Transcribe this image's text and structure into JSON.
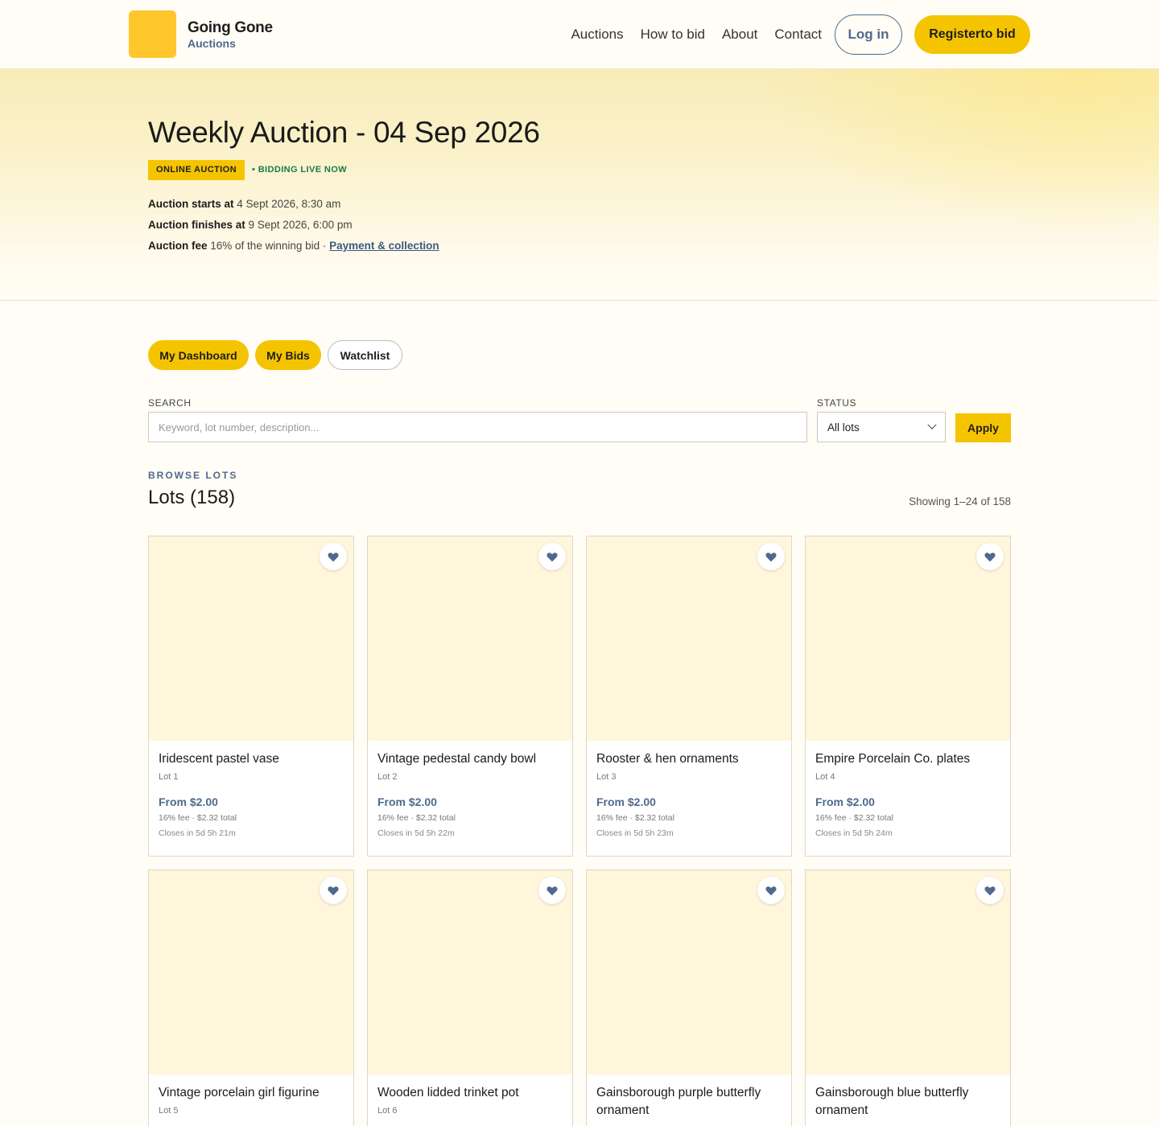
{
  "header": {
    "brand_name": "Going Gone",
    "brand_sub": "Auctions",
    "nav": [
      "Auctions",
      "How to bid",
      "About",
      "Contact"
    ],
    "login_label": "Log in",
    "register_label": "Registerto bid"
  },
  "hero": {
    "title": "Weekly Auction - 04 Sep 2026",
    "badge_online": "ONLINE AUCTION",
    "badge_live": "• BIDDING LIVE NOW",
    "starts_label": "Auction starts at",
    "starts_value": "4 Sept 2026, 8:30 am",
    "finishes_label": "Auction finishes at",
    "finishes_value": "9 Sept 2026, 6:00 pm",
    "fee_label": "Auction fee",
    "fee_value": "16% of the winning bid ·",
    "fee_link": "Payment & collection"
  },
  "tabs": [
    {
      "label": "My Dashboard",
      "active": true
    },
    {
      "label": "My Bids",
      "active": true
    },
    {
      "label": "Watchlist",
      "active": false
    }
  ],
  "filters": {
    "search_label": "SEARCH",
    "search_placeholder": "Keyword, lot number, description...",
    "status_label": "STATUS",
    "status_value": "All lots",
    "apply_label": "Apply"
  },
  "lots_section": {
    "browse_label": "BROWSE LOTS",
    "title": "Lots (158)",
    "showing": "Showing 1–24 of 158"
  },
  "lots": [
    {
      "title": "Iridescent pastel vase",
      "lot": "Lot 1",
      "price": "From $2.00",
      "fee": "16% fee · $2.32 total",
      "closes": "Closes in 5d 5h 21m"
    },
    {
      "title": "Vintage pedestal candy bowl",
      "lot": "Lot 2",
      "price": "From $2.00",
      "fee": "16% fee · $2.32 total",
      "closes": "Closes in 5d 5h 22m"
    },
    {
      "title": "Rooster & hen ornaments",
      "lot": "Lot 3",
      "price": "From $2.00",
      "fee": "16% fee · $2.32 total",
      "closes": "Closes in 5d 5h 23m"
    },
    {
      "title": "Empire Porcelain Co. plates",
      "lot": "Lot 4",
      "price": "From $2.00",
      "fee": "16% fee · $2.32 total",
      "closes": "Closes in 5d 5h 24m"
    },
    {
      "title": "Vintage porcelain girl figurine",
      "lot": "Lot 5"
    },
    {
      "title": "Wooden lidded trinket pot",
      "lot": "Lot 6"
    },
    {
      "title": "Gainsborough purple butterfly ornament",
      "lot": ""
    },
    {
      "title": "Gainsborough blue butterfly ornament",
      "lot": ""
    }
  ],
  "colors": {
    "accent": "#f5c400",
    "brand_blue": "#4e6a8d",
    "live_green": "#1d7a4a",
    "card_image_bg": "#fff6dc"
  }
}
